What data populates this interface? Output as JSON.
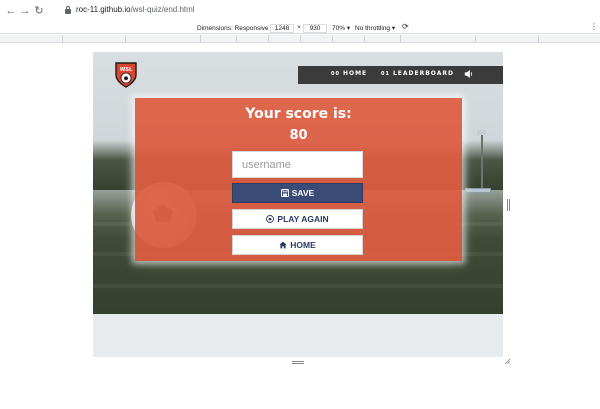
{
  "browser": {
    "url_host": "roc-11.github.io",
    "url_path": "/wsl-quiz/end.html"
  },
  "device_toolbar": {
    "dimensions_label": "Dimensions: Responsive",
    "width": "1248",
    "times": "×",
    "height": "930",
    "zoom": "70%",
    "throttling": "No throttling"
  },
  "site": {
    "logo_text": "WSL",
    "nav": {
      "home_num": "00",
      "home_label": "HOME",
      "leaderboard_num": "01",
      "leaderboard_label": "LEADERBOARD"
    }
  },
  "card": {
    "title": "Your score is:",
    "score": "80",
    "username_placeholder": "username",
    "save_label": "SAVE",
    "play_again_label": "PLAY AGAIN",
    "home_label": "HOME"
  },
  "colors": {
    "card": "#de5d42",
    "save_button": "#3a4b77",
    "navbar": "#3b3b3b"
  }
}
